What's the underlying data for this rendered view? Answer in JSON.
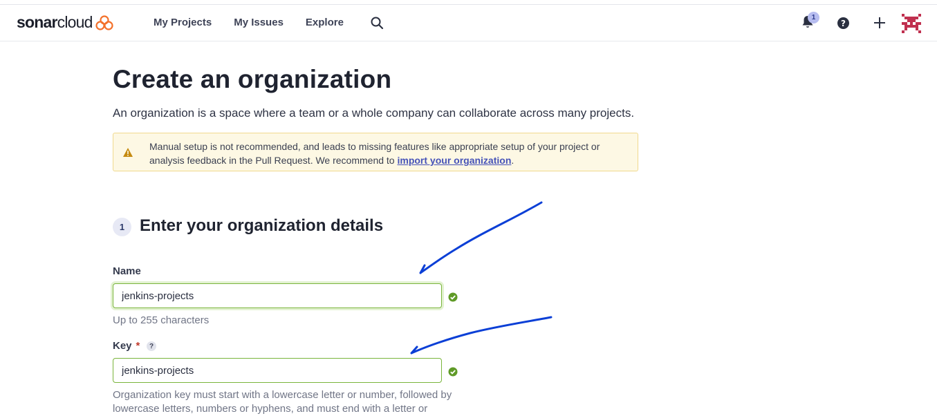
{
  "brand": {
    "name_bold": "sonar",
    "name_light": "cloud",
    "icon": "sonarcloud-cloud-logo",
    "accent": "#f3702a"
  },
  "nav": {
    "links": [
      "My Projects",
      "My Issues",
      "Explore"
    ],
    "search_icon": "search-icon",
    "notifications_count": "1",
    "notification_icon": "bell-icon",
    "help_icon": "help-icon",
    "add_icon": "plus-icon",
    "avatar_icon": "pixel-avatar-icon"
  },
  "page": {
    "title": "Create an organization",
    "subtitle": "An organization is a space where a team or a whole company can collaborate across many projects.",
    "alert": {
      "icon": "warning-icon",
      "text": "Manual setup is not recommended, and leads to missing features like appropriate setup of your project or analysis feedback in the Pull Request. We recommend to ",
      "link": "import your organization",
      "suffix": "."
    },
    "step": {
      "number": "1",
      "title": "Enter your organization details"
    },
    "name_field": {
      "label": "Name",
      "value": "jenkins-projects",
      "hint": "Up to 255 characters"
    },
    "key_field": {
      "label": "Key",
      "required_marker": "*",
      "help": "?",
      "value": "jenkins-projects",
      "hint_line1": "Organization key must start with a lowercase letter or number, followed by",
      "hint_line2": "lowercase letters, numbers or hyphens, and must end with a letter or"
    }
  },
  "colors": {
    "valid_green": "#79b43a",
    "annotation_blue": "#0b3fd6",
    "link_blue": "#4552b8"
  }
}
